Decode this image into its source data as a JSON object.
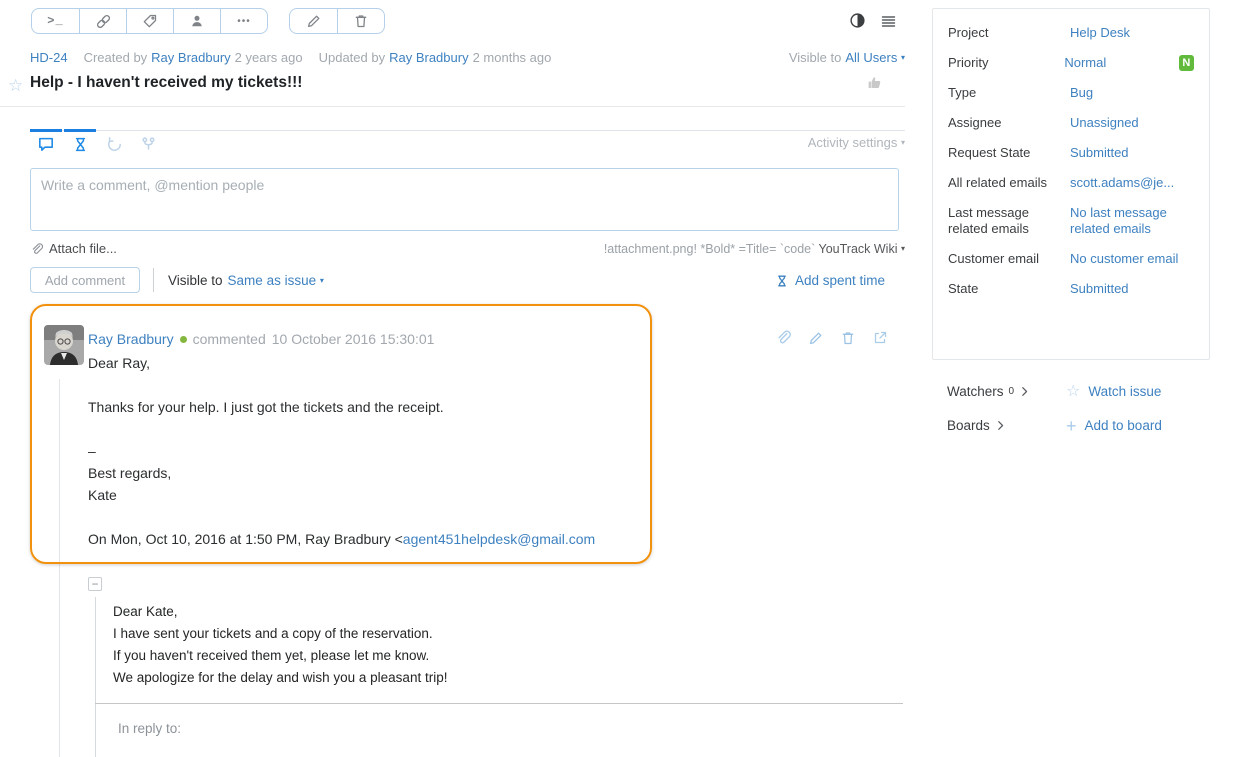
{
  "header": {
    "issue_id": "HD-24",
    "created_prefix": "Created by",
    "created_author": "Ray Bradbury",
    "created_ago": "2 years ago",
    "updated_prefix": "Updated by",
    "updated_author": "Ray Bradbury",
    "updated_ago": "2 months ago",
    "visible_to_label": "Visible to",
    "visible_to_value": "All Users",
    "title": "Help - I haven't received my tickets!!!"
  },
  "activity": {
    "settings_label": "Activity settings"
  },
  "editor": {
    "placeholder": "Write a comment, @mention people",
    "attach_label": "Attach file...",
    "wiki_hint": "!attachment.png! *Bold* =Title= `code`",
    "wiki_link": "YouTrack Wiki",
    "add_comment_label": "Add comment",
    "visible_to_label": "Visible to",
    "visible_to_value": "Same as issue",
    "add_spent_time_label": "Add spent time"
  },
  "comment": {
    "author": "Ray Bradbury",
    "action": "commented",
    "timestamp": "10 October 2016 15:30:01",
    "line1": "Dear Ray,",
    "line2": "Thanks for your help. I just got the tickets and the receipt.",
    "line3": "–",
    "line4": "Best regards,",
    "line5": "Kate",
    "line6_prefix": "On Mon, Oct 10, 2016 at 1:50 PM, Ray Bradbury <",
    "line6_email": "agent451helpdesk@gmail.com"
  },
  "quote": {
    "line1": "Dear Kate,",
    "line2": "I have sent your tickets and a copy of the reservation.",
    "line3": "If you haven't received them yet, please let me know.",
    "line4": "We apologize for the delay and wish you a pleasant trip!",
    "in_reply_to": "In reply to:"
  },
  "sidebar": {
    "fields": [
      {
        "label": "Project",
        "value": "Help Desk"
      },
      {
        "label": "Priority",
        "value": "Normal",
        "badge": "N"
      },
      {
        "label": "Type",
        "value": "Bug"
      },
      {
        "label": "Assignee",
        "value": "Unassigned"
      },
      {
        "label": "Request State",
        "value": "Submitted"
      },
      {
        "label": "All related emails",
        "value": "scott.adams@je..."
      },
      {
        "label": "Last message related emails",
        "value": "No last message related emails"
      },
      {
        "label": "Customer email",
        "value": "No customer email"
      },
      {
        "label": "State",
        "value": "Submitted"
      }
    ],
    "watchers_label": "Watchers",
    "watchers_count": "0",
    "watch_issue_label": "Watch issue",
    "boards_label": "Boards",
    "add_to_board_label": "Add to board"
  },
  "glyphs": {
    "terminal": ">_",
    "ellipsis": "•••",
    "caret": "▾",
    "star": "☆",
    "minus": "−",
    "plus": "+"
  },
  "colors": {
    "link_blue": "#3e81c0",
    "accent_orange": "#f2910d",
    "badge_green": "#62ba3c",
    "online_green": "#84b73f",
    "tab_active_blue": "#1a7fe0"
  }
}
